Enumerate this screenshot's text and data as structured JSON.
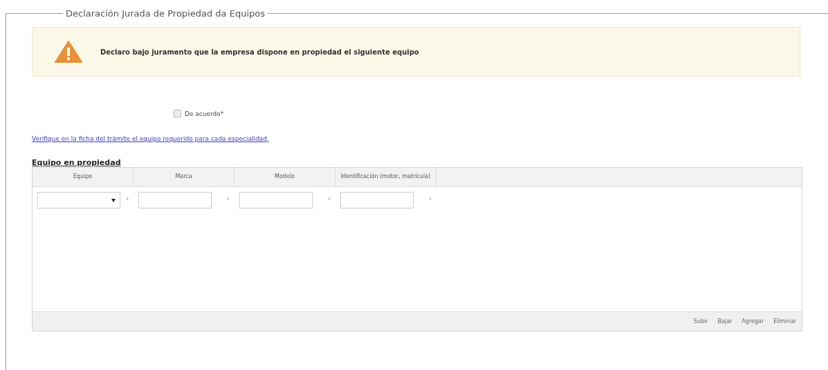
{
  "fieldset": {
    "legend": "Declaración Jurada de Propiedad da Equipos"
  },
  "warning": {
    "text": "Declaro bajo juramento que la empresa dispone en propiedad el siguiente equipo"
  },
  "agreement": {
    "label": "De acuerdo*",
    "checked": false
  },
  "link": "Verifique en la ficha del trámite el equipo requerido para cada especialidad.",
  "section_title": "Equipo en propiedad",
  "table": {
    "columns": [
      {
        "header": "Equipo",
        "kind": "select",
        "required_mark": "*"
      },
      {
        "header": "Marca",
        "kind": "text",
        "required_mark": "*"
      },
      {
        "header": "Modelo",
        "kind": "text",
        "required_mark": "*"
      },
      {
        "header": "Identificación (motor, matrícula)",
        "kind": "text",
        "required_mark": "*"
      }
    ],
    "actions": [
      "Subir",
      "Bajar",
      "Agregar",
      "Eliminar"
    ]
  }
}
